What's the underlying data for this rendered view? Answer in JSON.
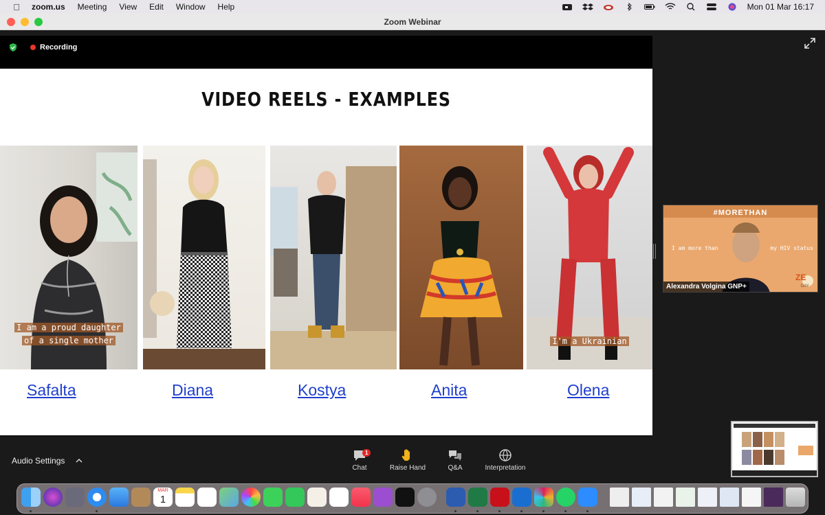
{
  "menubar": {
    "app": "zoom.us",
    "items": [
      "Meeting",
      "View",
      "Edit",
      "Window",
      "Help"
    ],
    "clock": "Mon 01 Mar  16:17"
  },
  "window": {
    "title": "Zoom Webinar"
  },
  "recording": {
    "label": "Recording"
  },
  "slide": {
    "title": "VIDEO REELS - EXAMPLES",
    "people": [
      {
        "name": "Safalta",
        "caption_lines": [
          "I am a proud daughter",
          "of a single mother"
        ]
      },
      {
        "name": "Diana",
        "caption_lines": []
      },
      {
        "name": "Kostya",
        "caption_lines": []
      },
      {
        "name": "Anita",
        "caption_lines": []
      },
      {
        "name": "Olena",
        "caption_lines": [
          "I'm a Ukrainian"
        ]
      }
    ]
  },
  "speaker": {
    "name": "Alexandra Volgina GNP+",
    "banner_hashtag": "#MORETHAN",
    "banner_left": "I am more than",
    "banner_right": "my HIV status",
    "logo_text": "ZE",
    "logo_sub": "DAY"
  },
  "toolbar": {
    "audio_settings": "Audio Settings",
    "chat": "Chat",
    "chat_badge": "1",
    "raise_hand": "Raise Hand",
    "qa": "Q&A",
    "interpretation": "Interpretation"
  },
  "dock": {
    "calendar_month": "MAR",
    "calendar_day": "1"
  },
  "colors": {
    "link": "#1f3fcc",
    "record_dot": "#e8372c",
    "badge": "#e02828"
  }
}
